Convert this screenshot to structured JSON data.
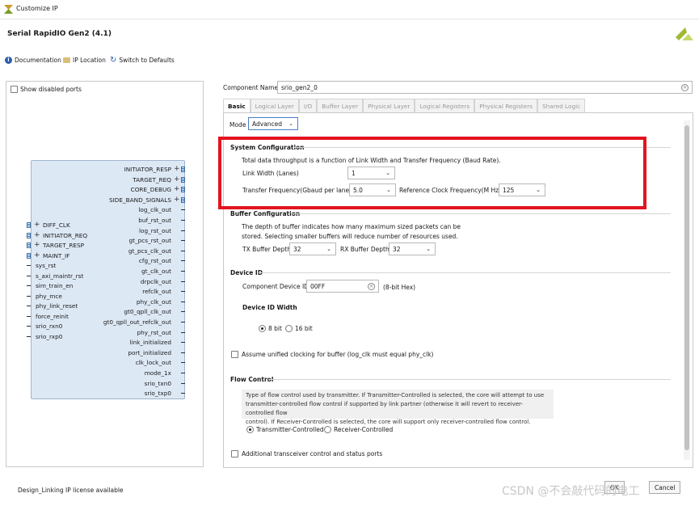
{
  "window": {
    "title": "Customize IP"
  },
  "header": {
    "title": "Serial RapidIO Gen2 (4.1)"
  },
  "toolbar": {
    "documentation": "Documentation",
    "ip_location": "IP Location",
    "switch_defaults": "Switch to Defaults"
  },
  "left_panel": {
    "show_disabled_ports": "Show disabled ports",
    "right_ports": [
      "INITIATOR_RESP",
      "TARGET_REQ",
      "CORE_DEBUG",
      "SIDE_BAND_SIGNALS",
      "log_clk_out",
      "buf_rst_out",
      "log_rst_out",
      "gt_pcs_rst_out",
      "gt_pcs_clk_out",
      "cfg_rst_out",
      "gt_clk_out",
      "drpclk_out",
      "refclk_out",
      "phy_clk_out",
      "gt0_qpll_clk_out",
      "gt0_qpll_out_refclk_out",
      "phy_rst_out",
      "link_initialized",
      "port_initialized",
      "clk_lock_out",
      "mode_1x",
      "srio_txn0",
      "srio_txp0"
    ],
    "left_ports": [
      "DIFF_CLK",
      "INITIATOR_REQ",
      "TARGET_RESP",
      "MAINT_IF",
      "sys_rst",
      "s_axi_maintr_rst",
      "sim_train_en",
      "phy_mce",
      "phy_link_reset",
      "force_reinit",
      "srio_rxn0",
      "srio_rxp0"
    ]
  },
  "component_name": {
    "label": "Component Name",
    "value": "srio_gen2_0"
  },
  "tabs": [
    "Basic",
    "Logical Layer",
    "I/O",
    "Buffer Layer",
    "Physical Layer",
    "Logical Registers",
    "Physical Registers",
    "Shared Logic"
  ],
  "basic": {
    "mode_label": "Mode",
    "mode_value": "Advanced",
    "system": {
      "title": "System Configuration",
      "desc": "Total data throughput is a function of Link Width and Transfer Frequency (Baud Rate).",
      "link_width_label": "Link Width (Lanes)",
      "link_width_value": "1",
      "transfer_freq_label": "Transfer Frequency(Gbaud per lane)",
      "transfer_freq_value": "5.0",
      "ref_clk_label": "Reference Clock Frequency(M Hz)",
      "ref_clk_value": "125"
    },
    "buffer": {
      "title": "Buffer Configuration",
      "desc1": "The depth of buffer indicates how many maximum sized packets can be",
      "desc2": "stored. Selecting smaller buffers will reduce number of resources used.",
      "tx_label": "TX Buffer Depth",
      "tx_value": "32",
      "rx_label": "RX Buffer Depth",
      "rx_value": "32"
    },
    "device_id": {
      "title": "Device ID",
      "component_label": "Component Device ID",
      "component_value": "00FF",
      "component_hint": "(8-bit Hex)",
      "width_title": "Device ID Width",
      "opt_8": "8 bit",
      "opt_16": "16 bit"
    },
    "unified_clock": "Assume unified clocking for buffer (log_clk must equal phy_clk)",
    "flow": {
      "title": "Flow Control",
      "note1": "Type of flow control used by transmitter. If Transmitter-Controlled is selected, the core will attempt to use",
      "note2": "transmitter-controlled flow control if supported by link partner (otherwise it will revert to receiver-controlled flow",
      "note3": "control). If Receiver-Controlled is selected, the core will support only receiver-controlled flow control.",
      "opt_tx": "Transmitter-Controlled",
      "opt_rx": "Receiver-Controlled"
    },
    "additional_ports": "Additional transceiver control and status ports"
  },
  "status": {
    "license": "Design_Linking IP license available"
  },
  "footer": {
    "ok": "OK",
    "cancel": "Cancel"
  },
  "watermark": "CSDN @不会敲代码的电工",
  "colors": {
    "highlight": "#e3141f",
    "symbol_fill": "#dde8f5",
    "bus": "#3a6ea5"
  }
}
